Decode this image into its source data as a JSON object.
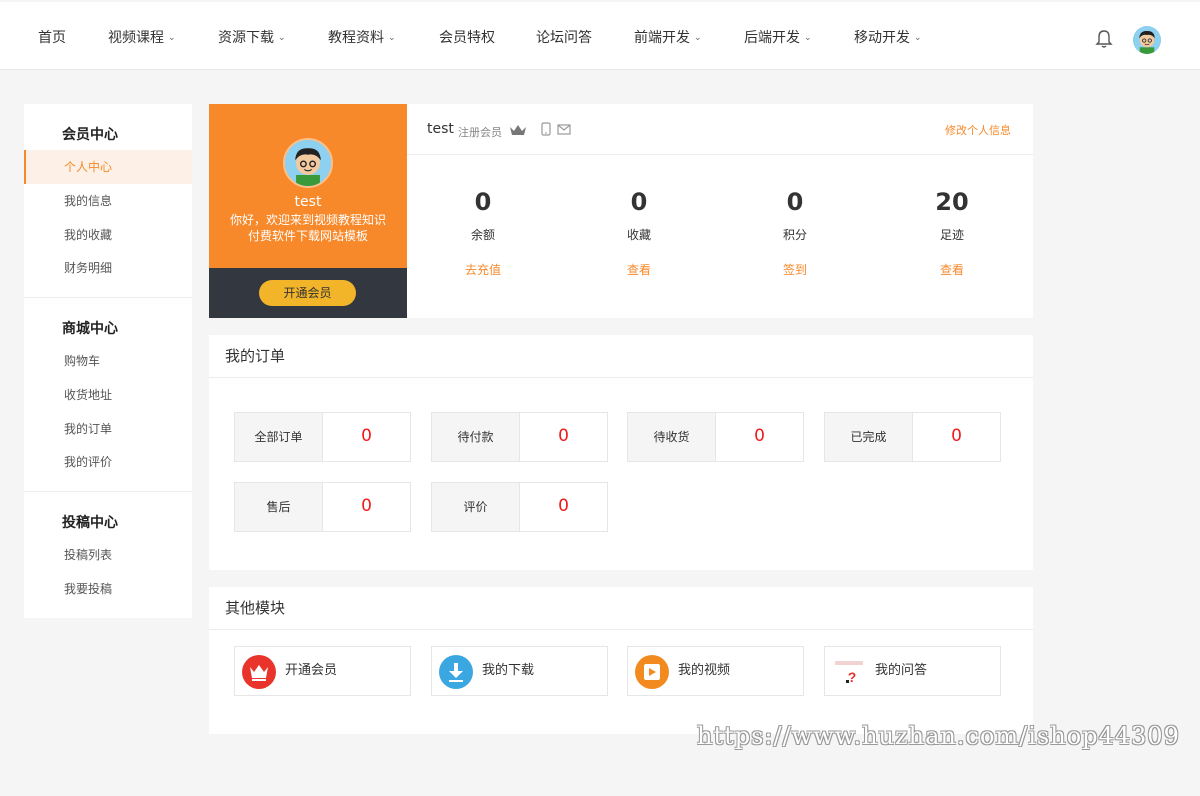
{
  "header": {
    "nav": [
      {
        "label": "首页",
        "dropdown": false
      },
      {
        "label": "视频课程",
        "dropdown": true
      },
      {
        "label": "资源下载",
        "dropdown": true
      },
      {
        "label": "教程资料",
        "dropdown": true
      },
      {
        "label": "会员特权",
        "dropdown": false
      },
      {
        "label": "论坛问答",
        "dropdown": false
      },
      {
        "label": "前端开发",
        "dropdown": true
      },
      {
        "label": "后端开发",
        "dropdown": true
      },
      {
        "label": "移动开发",
        "dropdown": true
      }
    ]
  },
  "sidebar": {
    "groups": [
      {
        "title": "会员中心",
        "items": [
          "个人中心",
          "我的信息",
          "我的收藏",
          "财务明细"
        ]
      },
      {
        "title": "商城中心",
        "items": [
          "购物车",
          "收货地址",
          "我的订单",
          "我的评价"
        ]
      },
      {
        "title": "投稿中心",
        "items": [
          "投稿列表",
          "我要投稿"
        ]
      }
    ],
    "active": "个人中心"
  },
  "profile": {
    "name": "test",
    "welcome": "你好，欢迎来到视频教程知识付费软件下载网站模板",
    "vip_button": "开通会员",
    "level": "注册会员",
    "edit_link": "修改个人信息",
    "stats": [
      {
        "value": "0",
        "label": "余额",
        "action": "去充值"
      },
      {
        "value": "0",
        "label": "收藏",
        "action": "查看"
      },
      {
        "value": "0",
        "label": "积分",
        "action": "签到"
      },
      {
        "value": "20",
        "label": "足迹",
        "action": "查看"
      }
    ]
  },
  "orders": {
    "title": "我的订单",
    "items": [
      {
        "label": "全部订单",
        "count": "0"
      },
      {
        "label": "待付款",
        "count": "0"
      },
      {
        "label": "待收货",
        "count": "0"
      },
      {
        "label": "已完成",
        "count": "0"
      },
      {
        "label": "售后",
        "count": "0"
      },
      {
        "label": "评价",
        "count": "0"
      }
    ]
  },
  "modules": {
    "title": "其他模块",
    "items": [
      {
        "label": "开通会员",
        "icon": "crown-icon",
        "color": "#e8342a"
      },
      {
        "label": "我的下载",
        "icon": "download-icon",
        "color": "#3aa7e0"
      },
      {
        "label": "我的视频",
        "icon": "play-icon",
        "color": "#f28a1f"
      },
      {
        "label": "我的问答",
        "icon": "question-icon",
        "color": "#e8342a"
      }
    ]
  },
  "watermark": "https://www.huzhan.com/ishop44309",
  "colors": {
    "accent": "#f7892a",
    "count_red": "#f01b1b",
    "dark_band": "#333740",
    "vip_button": "#f2b52a"
  }
}
